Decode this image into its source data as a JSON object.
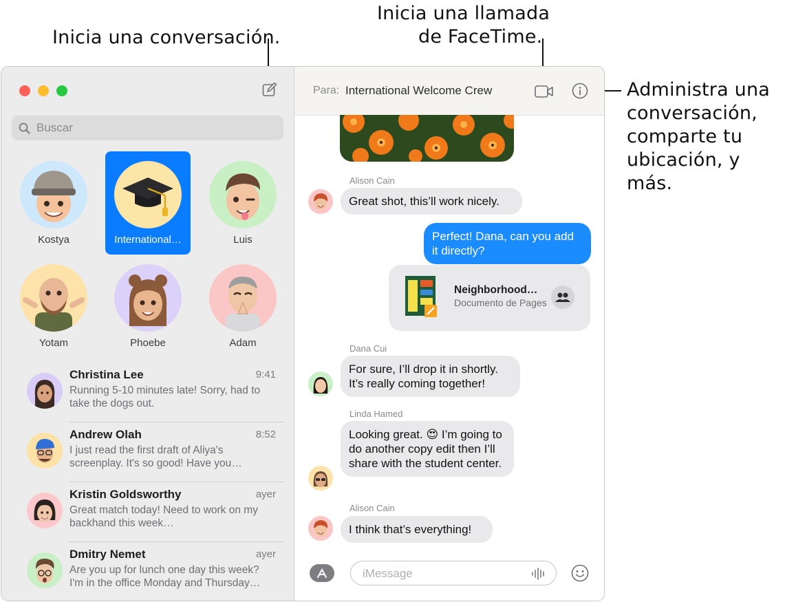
{
  "callouts": {
    "new_conversation": "Inicia una conversación.",
    "facetime_line1": "Inicia una llamada",
    "facetime_line2": "de FaceTime.",
    "manage_line1": "Administra una",
    "manage_line2": "conversación,",
    "manage_line3": "comparte tu",
    "manage_line4": "ubicación, y más."
  },
  "sidebar": {
    "search_placeholder": "Buscar",
    "pinned": [
      {
        "name": "Kostya",
        "color": "#cde8fa"
      },
      {
        "name": "International…",
        "color": "#fbe6a8",
        "selected": true
      },
      {
        "name": "Luis",
        "color": "#c9f0c4"
      },
      {
        "name": "Yotam",
        "color": "#fde3a9"
      },
      {
        "name": "Phoebe",
        "color": "#dcd1f8"
      },
      {
        "name": "Adam",
        "color": "#fbc6c6"
      }
    ],
    "conversations": [
      {
        "name": "Christina Lee",
        "time": "9:41",
        "preview": "Running 5-10 minutes late! Sorry, had to take the dogs out.",
        "color": "#d9cdf7"
      },
      {
        "name": "Andrew Olah",
        "time": "8:52",
        "preview": "I just read the first draft of Aliya's screenplay. It's so good! Have you…",
        "color": "#fde2a8"
      },
      {
        "name": "Kristin Goldsworthy",
        "time": "ayer",
        "preview": "Great match today! Need to work on my backhand this week…",
        "color": "#fbc8cc"
      },
      {
        "name": "Dmitry Nemet",
        "time": "ayer",
        "preview": "Are you up for lunch one day this week? I'm in the office Monday and Thursday…",
        "color": "#c9efc6"
      }
    ]
  },
  "chat": {
    "to_label": "Para:",
    "to_name": "International Welcome Crew",
    "messages": {
      "alison1_sender": "Alison Cain",
      "alison1_text": "Great shot, this’ll work nicely.",
      "me_text": "Perfect! Dana, can you add it directly?",
      "attachment_title": "Neighborhood…",
      "attachment_subtitle": "Documento de Pages",
      "dana_sender": "Dana Cui",
      "dana_text": "For sure, I’ll drop it in shortly. It’s really coming together!",
      "linda_sender": "Linda Hamed",
      "linda_text": "Looking great. 😍 I’m going to do another copy edit then I’ll share with the student center.",
      "alison2_sender": "Alison Cain",
      "alison2_text": "I think that’s everything!"
    },
    "input_placeholder": "iMessage"
  },
  "colors": {
    "accent_blue": "#0a7cff",
    "bubble_blue": "#1a8cff",
    "close": "#ff5f57",
    "minimize": "#febc2e",
    "zoom": "#28c840"
  },
  "icons": [
    "compose-icon",
    "search-icon",
    "video-icon",
    "info-icon",
    "app-store-icon",
    "audio-waveform-icon",
    "emoji-icon",
    "share-people-icon"
  ]
}
